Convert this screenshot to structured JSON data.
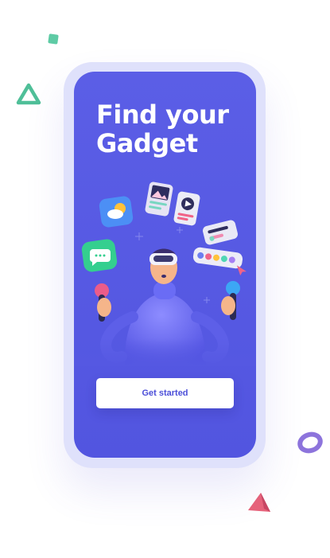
{
  "headline": {
    "line1": "Find your",
    "line2": "Gadget"
  },
  "cta": {
    "label": "Get started"
  },
  "colors": {
    "screen": "#5b5ee6",
    "frame": "#dfe1fb",
    "button_text": "#4b4ed8",
    "deco_green": "#5ecba5",
    "deco_pink": "#e8637a",
    "deco_purple": "#8d74dc"
  },
  "icons": [
    "weather-app-icon",
    "gallery-app-icon",
    "video-player-icon",
    "settings-panel-icon",
    "chat-app-icon",
    "color-palette-icon"
  ]
}
